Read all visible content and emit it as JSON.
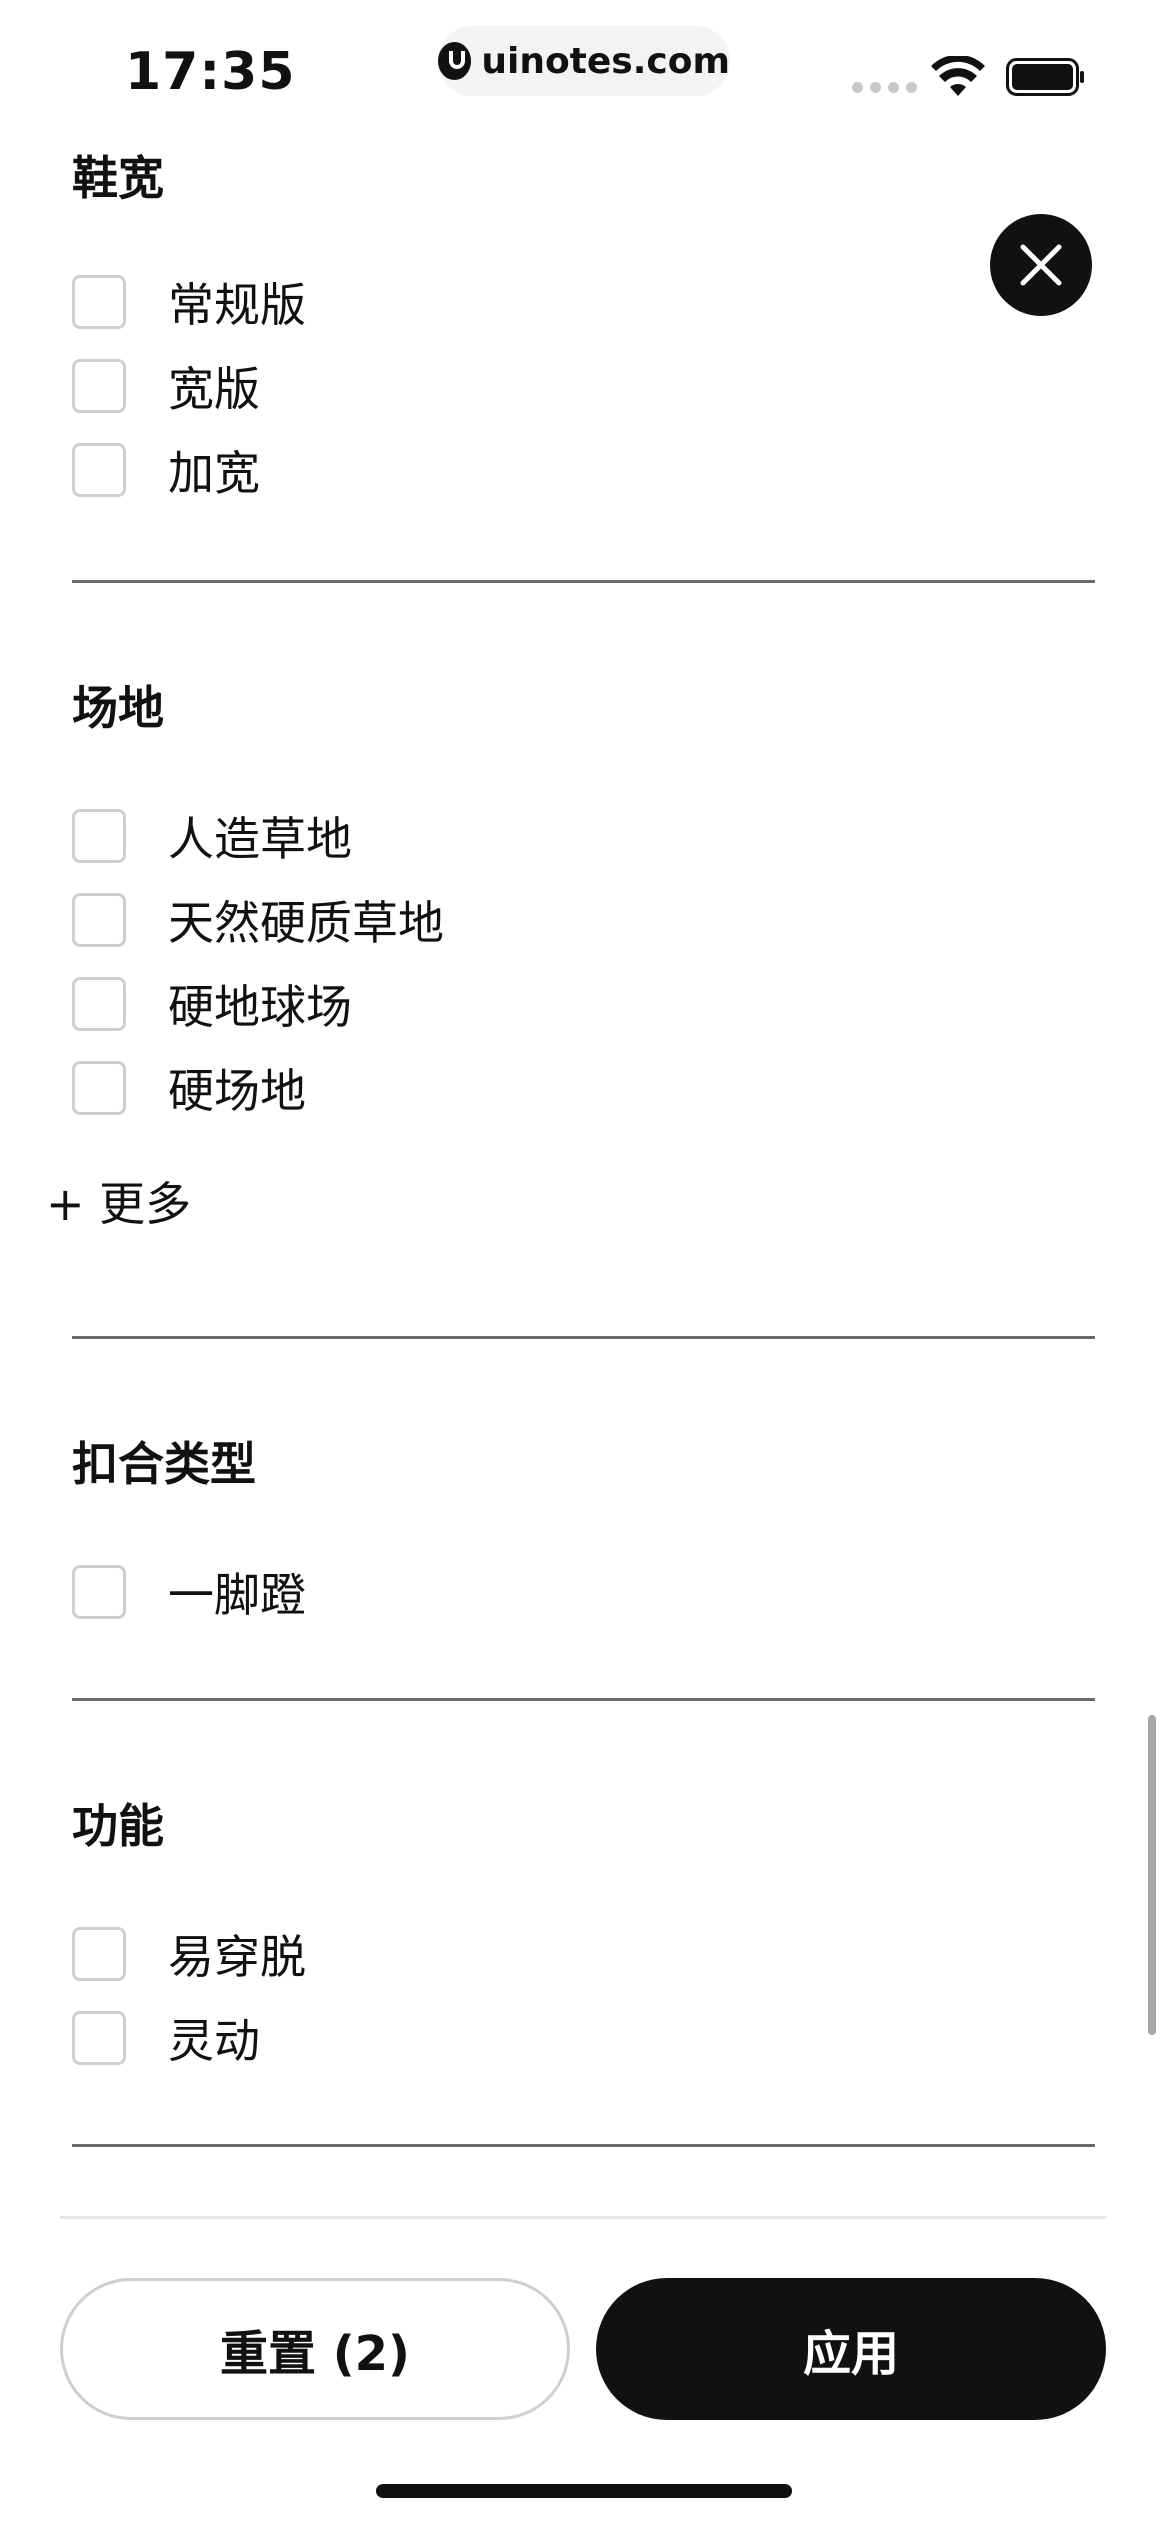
{
  "status_bar": {
    "time": "17:35",
    "url": "uinotes.com"
  },
  "sections": [
    {
      "title": "鞋宽",
      "options": [
        "常规版",
        "宽版",
        "加宽"
      ]
    },
    {
      "title": "场地",
      "options": [
        "人造草地",
        "天然硬质草地",
        "硬地球场",
        "硬场地"
      ],
      "more_label": "+ 更多"
    },
    {
      "title": "扣合类型",
      "options": [
        "一脚蹬"
      ]
    },
    {
      "title": "功能",
      "options": [
        "易穿脱",
        "灵动"
      ]
    }
  ],
  "footer": {
    "reset_label": "重置 (2)",
    "apply_label": "应用"
  },
  "colors": {
    "primary": "#111111",
    "checkbox_border": "#cfcfcf",
    "divider": "#6b6b6b"
  }
}
